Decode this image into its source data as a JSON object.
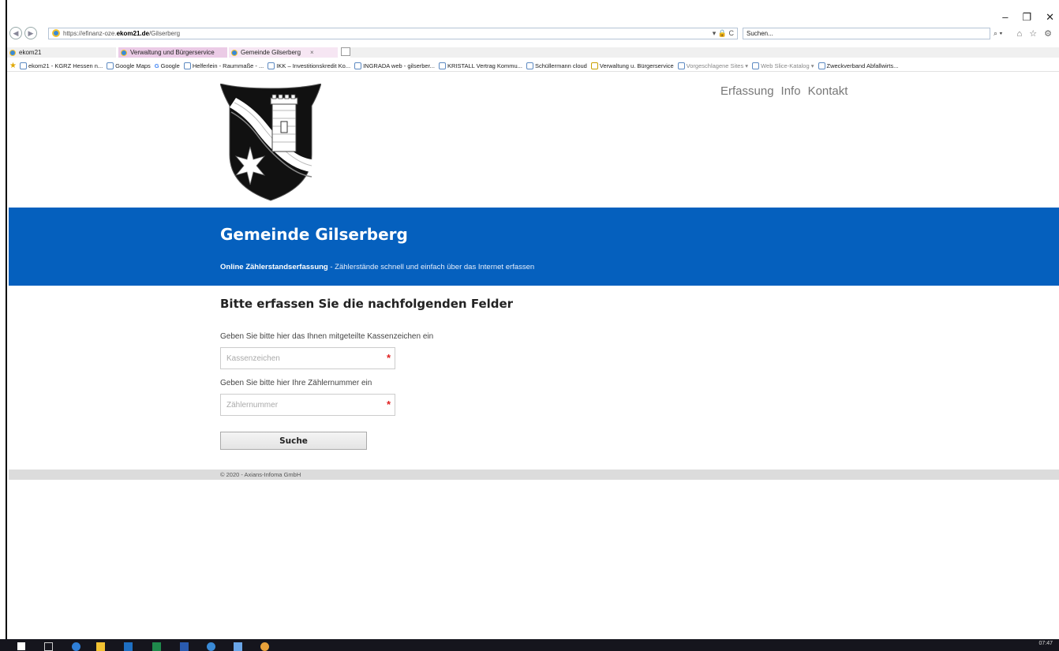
{
  "browser": {
    "url_prefix": "https://efinanz-oze.",
    "url_domain": "ekom21.de",
    "url_path": "/Gilserberg",
    "addr_icons": "▾ 🔒 C",
    "search_placeholder": "Suchen...",
    "search_tools": "⌕ ▾",
    "tool_icons": "⌂ ☆ ⚙",
    "window_controls": [
      "–",
      "❐",
      "✕"
    ],
    "tabs": [
      {
        "label": "ekom21"
      },
      {
        "label": "Verwaltung und Bürgerservice"
      },
      {
        "label": "Gemeinde Gilserberg",
        "close": "×"
      }
    ],
    "favorites": [
      "ekom21 - KGRZ Hessen n...",
      "Google Maps",
      "Google",
      "Helferlein - Raummaße - ...",
      "IKK – Investitionskredit Ko...",
      "INGRADA web - gilserber...",
      "KRISTALL Vertrag Kommu...",
      "Schüllermann cloud",
      "Verwaltung u. Bürgerservice",
      "Vorgeschlagene Sites ▾",
      "Web Slice-Katalog ▾",
      "Zweckverband Abfallwirts..."
    ]
  },
  "nav": {
    "items": [
      "Erfassung",
      "Info",
      "Kontakt"
    ]
  },
  "banner": {
    "title": "Gemeinde Gilserberg",
    "subtitle_bold": "Online Zählerstandserfassung",
    "subtitle_rest": " - Zählerstände schnell und einfach über das Internet erfassen"
  },
  "form": {
    "heading": "Bitte erfassen Sie die nachfolgenden Felder",
    "kassenzeichen_label": "Geben Sie bitte hier das Ihnen mitgeteilte Kassenzeichen ein",
    "kassenzeichen_placeholder": "Kassenzeichen",
    "zaehler_label": "Geben Sie bitte hier Ihre Zählernummer ein",
    "zaehler_placeholder": "Zählernummer",
    "required_mark": "*",
    "submit_label": "Suche"
  },
  "footer": {
    "text": "© 2020 - Axians-Infoma GmbH"
  },
  "taskbar": {
    "time": "07:47"
  },
  "colors": {
    "banner": "#0560be",
    "required": "#e02020",
    "footer": "#dcdcdc"
  }
}
